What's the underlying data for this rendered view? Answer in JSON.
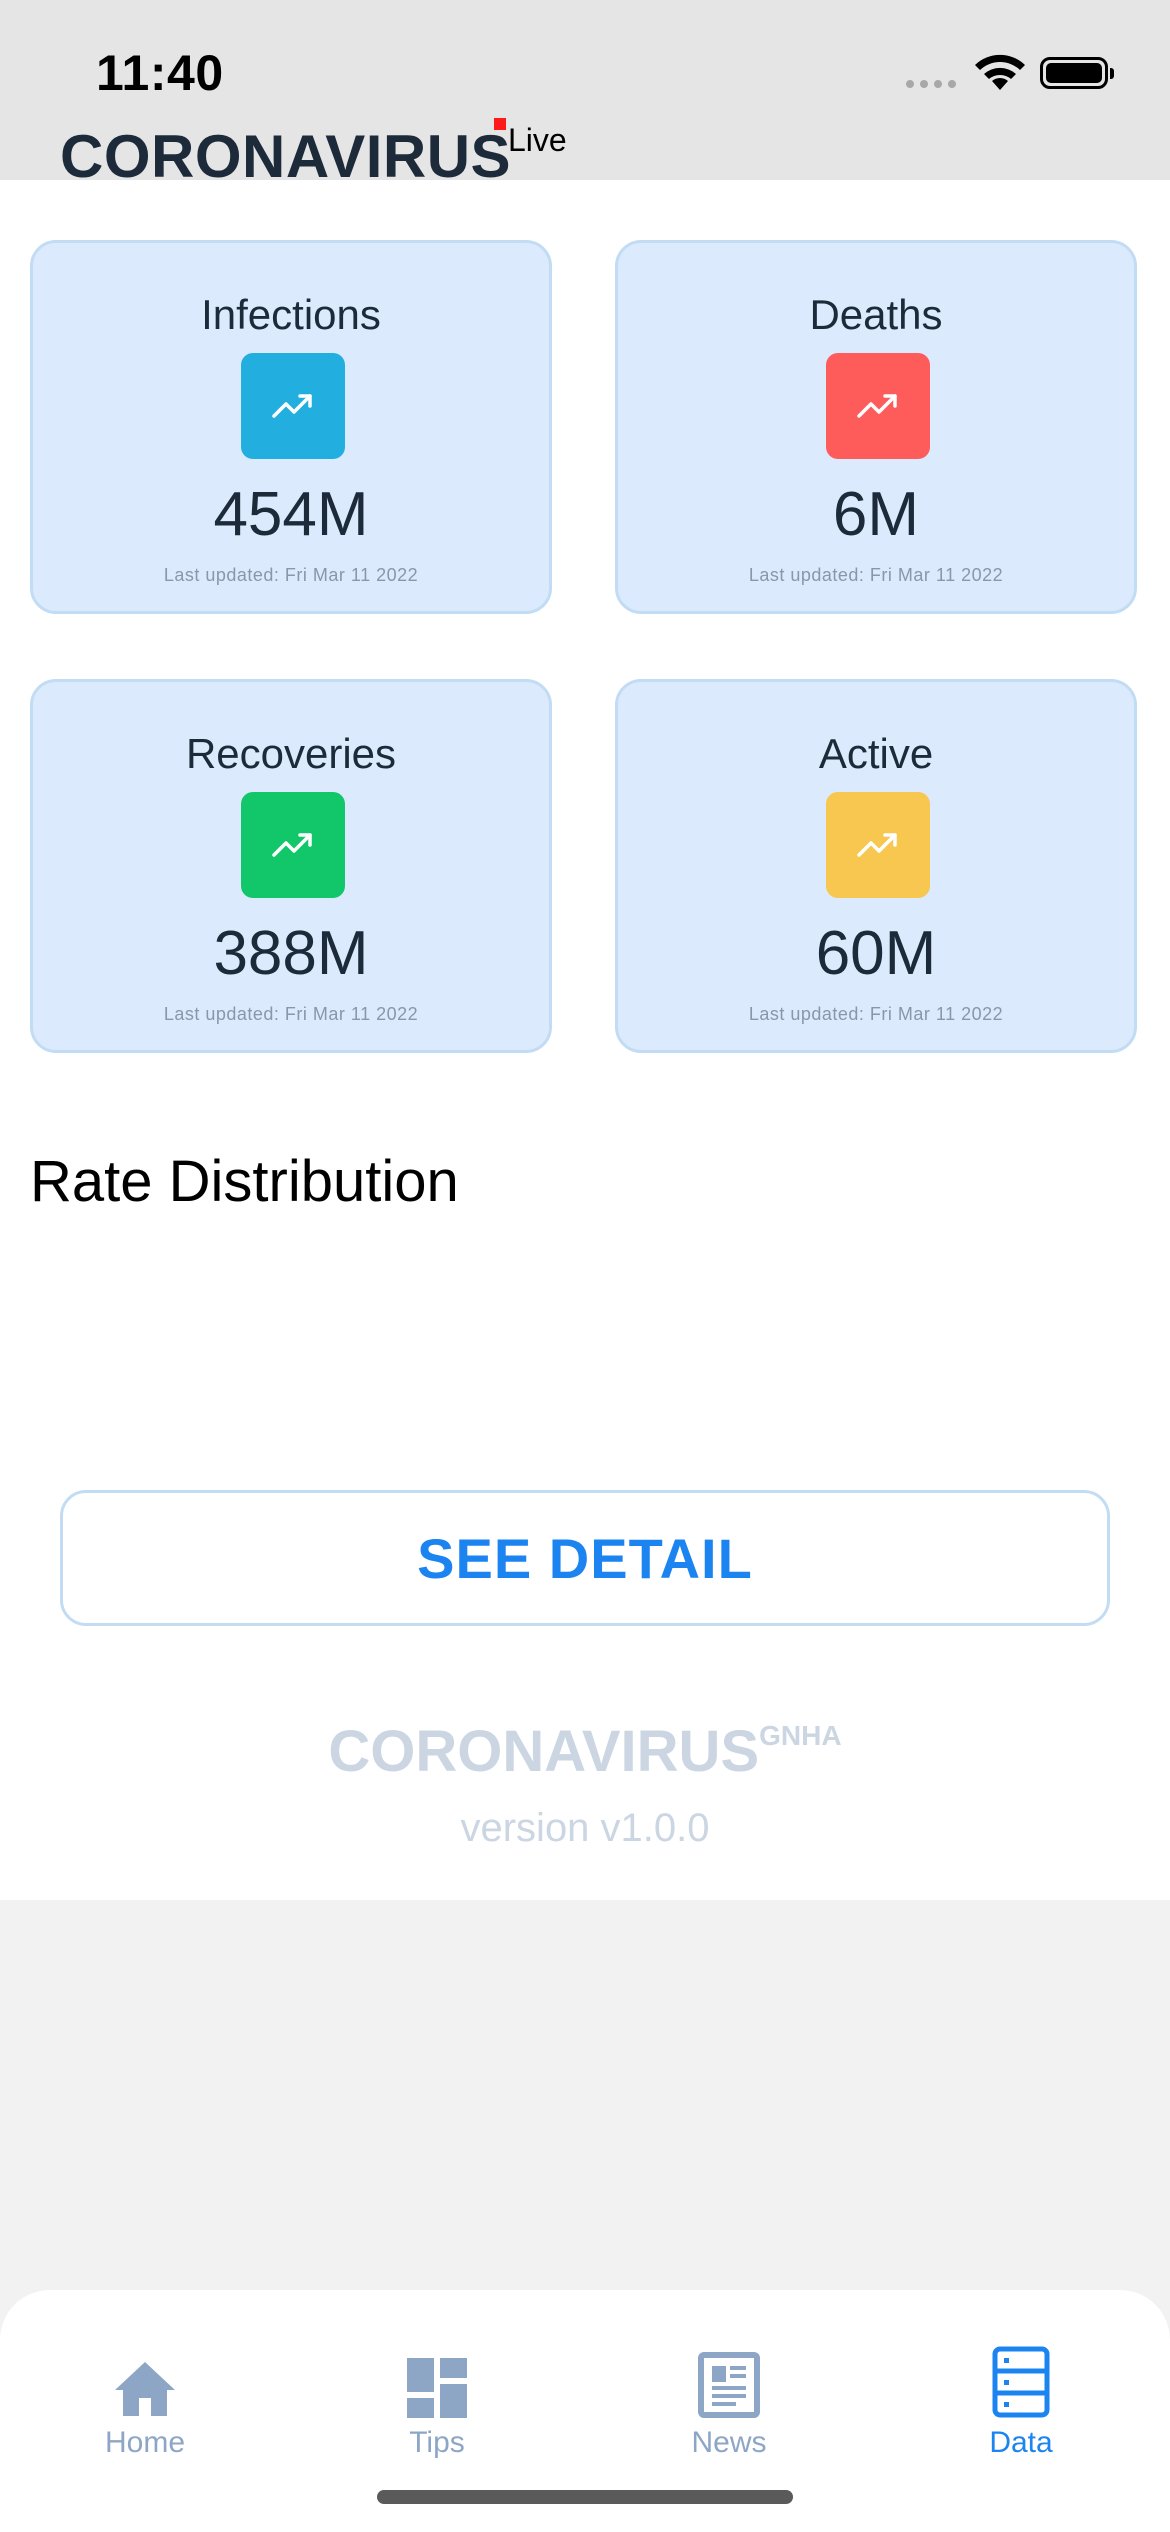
{
  "status_bar": {
    "time": "11:40"
  },
  "header": {
    "title": "CORONAVIRUS",
    "live_label": "Live"
  },
  "cards": [
    {
      "label": "Infections",
      "value": "454M",
      "updated": "Last updated: Fri Mar 11 2022",
      "color": "#23aee0",
      "icon": "trending-up-icon"
    },
    {
      "label": "Deaths",
      "value": "6M",
      "updated": "Last updated: Fri Mar 11 2022",
      "color": "#fe5b5b",
      "icon": "trending-up-icon"
    },
    {
      "label": "Recoveries",
      "value": "388M",
      "updated": "Last updated: Fri Mar 11 2022",
      "color": "#12c66a",
      "icon": "trending-up-icon"
    },
    {
      "label": "Active",
      "value": "60M",
      "updated": "Last updated: Fri Mar 11 2022",
      "color": "#f7c74f",
      "icon": "trending-up-icon"
    }
  ],
  "section": {
    "title": "Rate Distribution"
  },
  "see_detail_label": "SEE DETAIL",
  "footer": {
    "brand": "CORONAVIRUS",
    "brand_sup": "GNHA",
    "version": "version v1.0.0"
  },
  "tabbar": {
    "tabs": [
      {
        "label": "Home",
        "icon": "home-icon",
        "active": false
      },
      {
        "label": "Tips",
        "icon": "dashboard-icon",
        "active": false
      },
      {
        "label": "News",
        "icon": "newspaper-icon",
        "active": false
      },
      {
        "label": "Data",
        "icon": "storage-icon",
        "active": true
      }
    ]
  },
  "colors": {
    "accent": "#1b84f0",
    "inactive_tab": "#8ea6c6",
    "card_bg": "#dbeafc",
    "live_dot": "#ff1a1a"
  }
}
